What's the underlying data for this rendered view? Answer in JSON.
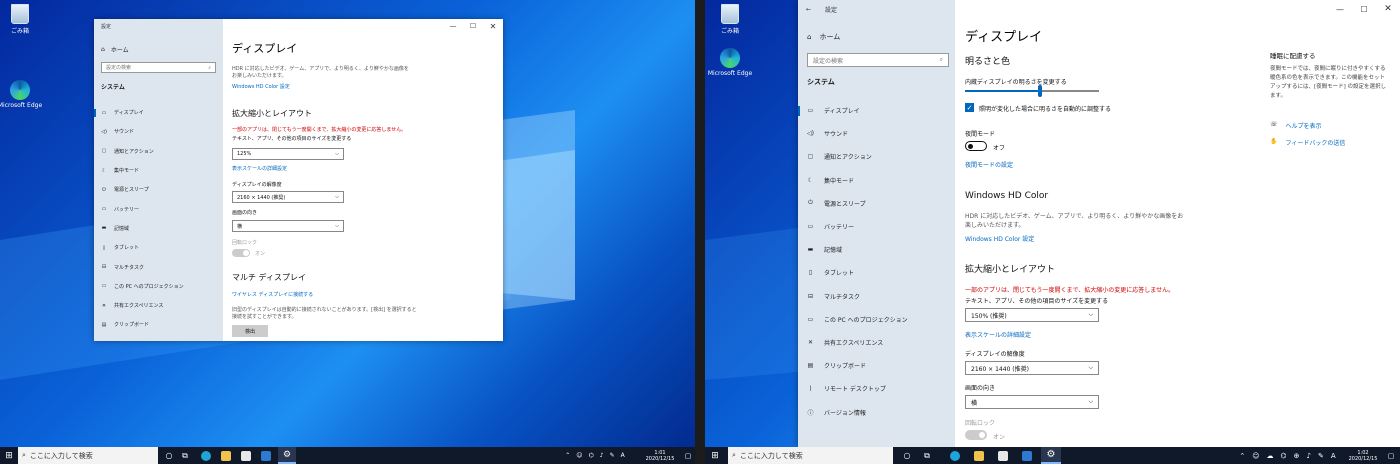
{
  "colors": {
    "accent": "#0067c0",
    "warning": "#d00000",
    "nav_bg": "#dde6ef",
    "taskbar": "#10192a"
  },
  "desktop": {
    "recycle_bin": "ごみ箱",
    "edge": "Microsoft Edge"
  },
  "taskbar": {
    "search_placeholder": "ここに入力して検索",
    "language": "A",
    "left_time": "1:01",
    "left_date": "2020/12/15",
    "right_time": "1:02",
    "right_date": "2020/12/15"
  },
  "window": {
    "title": "設定",
    "home": "ホーム",
    "search_placeholder": "設定の検索",
    "section": "システム",
    "nav": [
      "ディスプレイ",
      "サウンド",
      "通知とアクション",
      "集中モード",
      "電源とスリープ",
      "バッテリー",
      "記憶域",
      "タブレット",
      "マルチタスク",
      "この PC へのプロジェクション",
      "共有エクスペリエンス",
      "クリップボード",
      "リモート デスクトップ",
      "バージョン情報"
    ],
    "nav_icons": [
      "display-icon",
      "sound-icon",
      "notification-icon",
      "focus-moon-icon",
      "power-icon",
      "battery-icon",
      "storage-icon",
      "tablet-icon",
      "multitask-icon",
      "projection-icon",
      "share-icon",
      "clipboard-icon",
      "remote-icon",
      "info-icon"
    ],
    "page_title": "ディスプレイ"
  },
  "left": {
    "hdr_desc": "HDR に対応したビデオ、ゲーム、アプリで、より明るく、より鮮やかな画像をお楽しみいただけます。",
    "hdr_link": "Windows HD Color 設定",
    "scale_heading": "拡大縮小とレイアウト",
    "warning": "一部のアプリは、閉じてもう一度開くまで、拡大縮小の変更に応答しません。",
    "text_size_label": "テキスト、アプリ、その他の項目のサイズを変更する",
    "scale_value": "125%",
    "advanced_scale_link": "表示スケールの詳細設定",
    "resolution_label": "ディスプレイの解像度",
    "resolution_value": "2160 × 1440 (推奨)",
    "orientation_label": "画面の向き",
    "orientation_value": "横",
    "rotation_lock_label": "回転ロック",
    "rotation_lock_state": "オン",
    "multi_heading": "マルチ ディスプレイ",
    "wireless_link": "ワイヤレス ディスプレイに接続する",
    "old_display_desc": "旧型のディスプレイは自動的に接続されないことがあります。[検出] を選択すると接続を試すことができます。",
    "detect_button": "検出"
  },
  "right": {
    "brightness_heading": "明るさと色",
    "brightness_label": "内蔵ディスプレイの明るさを変更する",
    "brightness_level": 0.56,
    "auto_brightness": "照明が変化した場合に明るさを自動的に調整する",
    "night_label": "夜間モード",
    "night_state": "オフ",
    "night_settings_link": "夜間モードの設定",
    "hdr_heading": "Windows HD Color",
    "hdr_desc": "HDR に対応したビデオ、ゲーム、アプリで、より明るく、より鮮やかな画像をお楽しみいただけます。",
    "hdr_link": "Windows HD Color 設定",
    "scale_heading": "拡大縮小とレイアウト",
    "warning": "一部のアプリは、閉じてもう一度開くまで、拡大縮小の変更に応答しません。",
    "text_size_label": "テキスト、アプリ、その他の項目のサイズを変更する",
    "scale_value": "150% (推奨)",
    "advanced_scale_link": "表示スケールの詳細設定",
    "resolution_label": "ディスプレイの解像度",
    "resolution_value": "2160 × 1440 (推奨)",
    "orientation_label": "画面の向き",
    "orientation_value": "横",
    "rotation_lock_label": "回転ロック",
    "rotation_lock_state": "オン",
    "tip_title": "睡眠に配慮する",
    "tip_body": "夜間モードでは、夜間に眠りに付きやすくする暖色系の色を表示できます。この機能をセットアップするには、[夜間モード] の設定を選択します。",
    "help_link": "ヘルプを表示",
    "feedback_link": "フィードバックの送信"
  }
}
